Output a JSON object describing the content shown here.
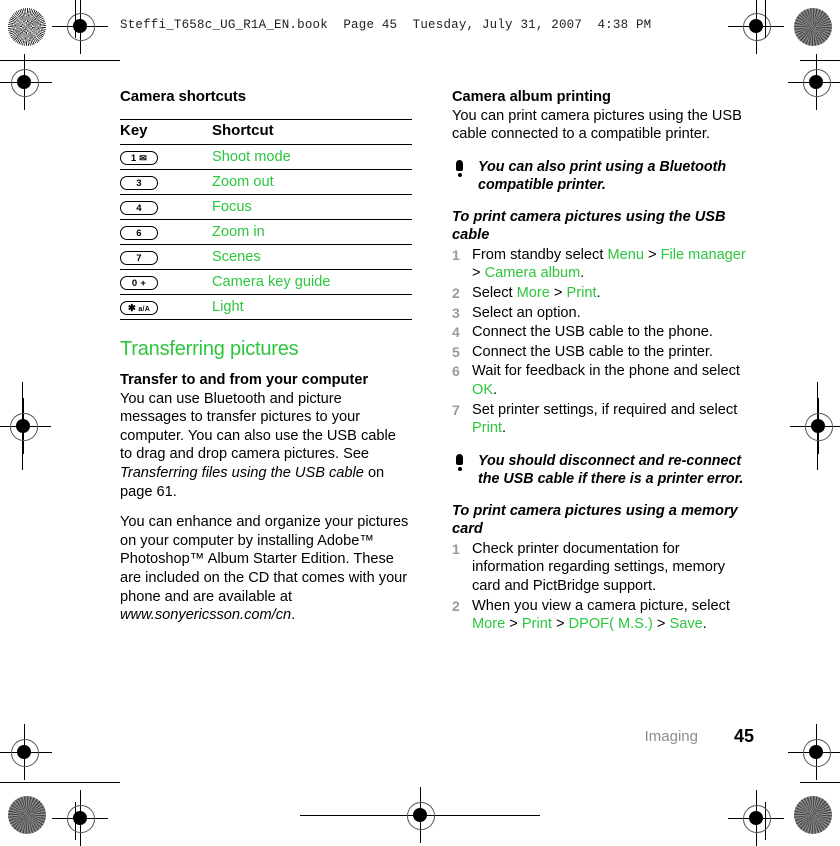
{
  "print_header": {
    "text": "Steffi_T658c_UG_R1A_EN.book  Page 45  Tuesday, July 31, 2007  4:38 PM"
  },
  "colors": {
    "accent_green": "#2cc63f",
    "step_number_gray": "#9a9a9a",
    "footer_gray": "#8d8d8d",
    "text_black": "#000000"
  },
  "left_column": {
    "heading": "Camera shortcuts",
    "table": {
      "columns": [
        "Key",
        "Shortcut"
      ],
      "rows": [
        {
          "key": "1",
          "key_extra": "✉",
          "shortcut": "Shoot mode"
        },
        {
          "key": "3",
          "key_extra": "",
          "shortcut": "Zoom out"
        },
        {
          "key": "4",
          "key_extra": "",
          "shortcut": "Focus"
        },
        {
          "key": "6",
          "key_extra": "",
          "shortcut": "Zoom in"
        },
        {
          "key": "7",
          "key_extra": "",
          "shortcut": "Scenes"
        },
        {
          "key": "0 +",
          "key_extra": "",
          "shortcut": "Camera key guide"
        },
        {
          "key": "✱",
          "key_extra": "a/A",
          "shortcut": "Light"
        }
      ]
    },
    "section_heading": "Transferring pictures",
    "subheading": "Transfer to and from your computer",
    "para1_a": "You can use Bluetooth and picture messages to transfer pictures to your computer. You can also use the USB cable to drag and drop camera pictures. See ",
    "para1_italic": "Transferring files using the USB cable",
    "para1_b": " on page 61.",
    "para2_a": "You can enhance and organize your pictures on your computer by installing Adobe™ Photoshop™ Album Starter Edition. These are included on the CD that comes with your phone and are available at ",
    "para2_italic": "www.sonyericsson.com/cn",
    "para2_b": "."
  },
  "right_column": {
    "subheading": "Camera album printing",
    "intro": "You can print camera pictures using the USB cable connected to a compatible printer.",
    "note1": "You can also print using a Bluetooth compatible printer.",
    "proc1_title": "To print camera pictures using the USB cable",
    "proc1_steps": [
      {
        "pre": "From standby select ",
        "links": [
          "Menu",
          "File manager",
          "Camera album"
        ],
        "post": "."
      },
      {
        "pre": "Select ",
        "links": [
          "More",
          "Print"
        ],
        "post": "."
      },
      {
        "pre": "Select an option.",
        "links": [],
        "post": ""
      },
      {
        "pre": "Connect the USB cable to the phone.",
        "links": [],
        "post": ""
      },
      {
        "pre": "Connect the USB cable to the printer.",
        "links": [],
        "post": ""
      },
      {
        "pre": "Wait for feedback in the phone and select ",
        "links": [
          "OK"
        ],
        "post": "."
      },
      {
        "pre": "Set printer settings, if required and select ",
        "links": [
          "Print"
        ],
        "post": "."
      }
    ],
    "note2": "You should disconnect and re-connect the USB cable if there is a printer error.",
    "proc2_title": "To print camera pictures using a memory card",
    "proc2_steps": [
      {
        "pre": "Check printer documentation for information regarding settings, memory card and PictBridge support.",
        "links": [],
        "post": ""
      },
      {
        "pre": "When you view a camera picture, select ",
        "links": [
          "More",
          "Print",
          "DPOF( M.S.)",
          "Save"
        ],
        "post": "."
      }
    ]
  },
  "footer": {
    "section": "Imaging",
    "page_number": "45"
  },
  "separator": " > "
}
